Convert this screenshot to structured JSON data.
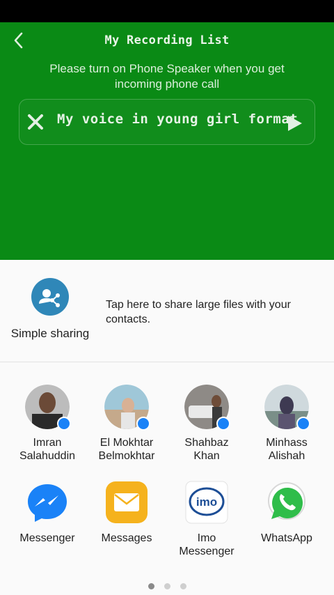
{
  "header": {
    "title": "My Recording List"
  },
  "notice": "Please turn on Phone Speaker when you get incoming phone call",
  "recordings": [
    {
      "title": "My voice in young girl format"
    }
  ],
  "share_sheet": {
    "simple_sharing": {
      "label": "Simple sharing",
      "description": "Tap here to share large files with your contacts."
    },
    "contacts": [
      {
        "name": "Imran Salahuddin",
        "line1": "Imran",
        "line2": "Salahuddin"
      },
      {
        "name": "El Mokhtar Belmokhtar",
        "line1": "El Mokhtar",
        "line2": "Belmokhtar"
      },
      {
        "name": "Shahbaz Khan",
        "line1": "Shahbaz",
        "line2": "Khan"
      },
      {
        "name": "Minhass Alishah",
        "line1": "Minhass",
        "line2": "Alishah"
      }
    ],
    "apps": [
      {
        "line1": "Messenger",
        "line2": "",
        "icon": "messenger-icon"
      },
      {
        "line1": "Messages",
        "line2": "",
        "icon": "messages-icon"
      },
      {
        "line1": "Imo",
        "line2": "Messenger",
        "icon": "imo-icon"
      },
      {
        "line1": "WhatsApp",
        "line2": "",
        "icon": "whatsapp-icon"
      }
    ],
    "pager": {
      "pages": 3,
      "current": 1
    }
  },
  "colors": {
    "app_green": "#0a8a15",
    "share_blue": "#2f87b8",
    "messenger_blue": "#1a82f7",
    "whatsapp_green": "#2fbd4a"
  }
}
